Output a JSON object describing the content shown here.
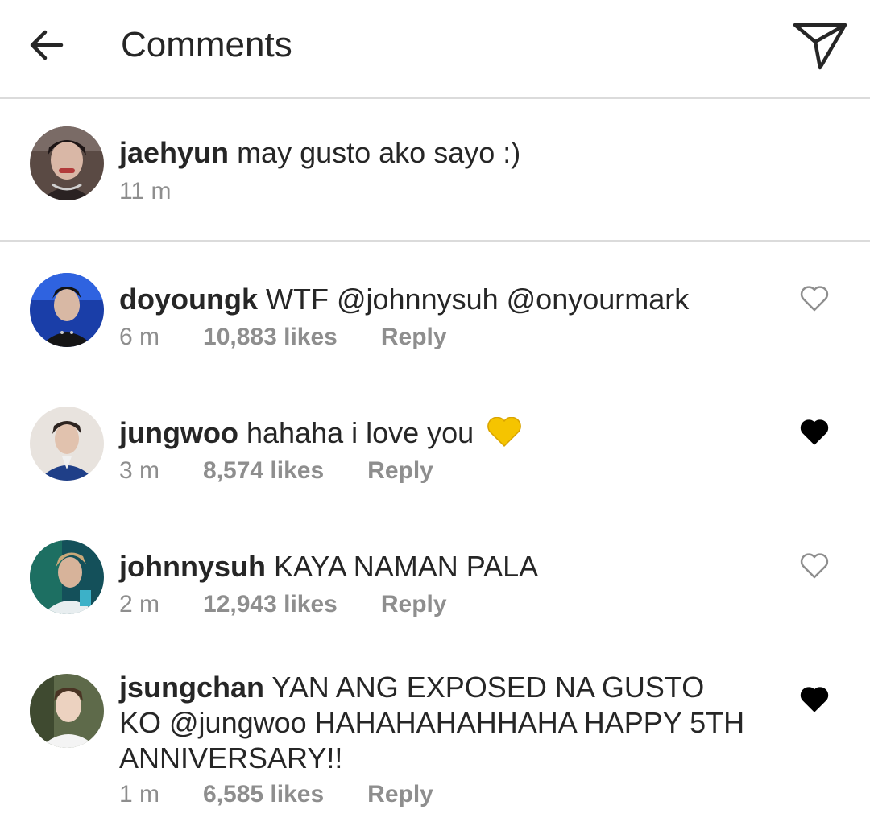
{
  "header": {
    "title": "Comments",
    "back_icon": "arrow-left-icon",
    "send_icon": "paper-plane-icon"
  },
  "caption": {
    "username": "jaehyun",
    "text": "may gusto ako sayo :)",
    "time": "11 m"
  },
  "comments": [
    {
      "username": "doyoungk",
      "text": "WTF @johnnysuh @onyourmark",
      "time": "6 m",
      "likes": "10,883 likes",
      "reply": "Reply",
      "liked": false
    },
    {
      "username": "jungwoo",
      "text": "hahaha i love you",
      "emoji": "yellow-heart-emoji",
      "time": "3 m",
      "likes": "8,574 likes",
      "reply": "Reply",
      "liked": true
    },
    {
      "username": "johnnysuh",
      "text": "KAYA NAMAN PALA",
      "time": "2 m",
      "likes": "12,943 likes",
      "reply": "Reply",
      "liked": false
    },
    {
      "username": "jsungchan",
      "text": "YAN ANG EXPOSED NA GUSTO KO @jungwoo HAHAHAHAHHAHA HAPPY 5TH ANNIVERSARY!!",
      "time": "1 m",
      "likes": "6,585 likes",
      "reply": "Reply",
      "liked": true
    }
  ],
  "colors": {
    "text": "#262626",
    "secondary": "#8e8e8e",
    "divider": "#dbdbdb",
    "emoji_heart": "#f5c400"
  }
}
